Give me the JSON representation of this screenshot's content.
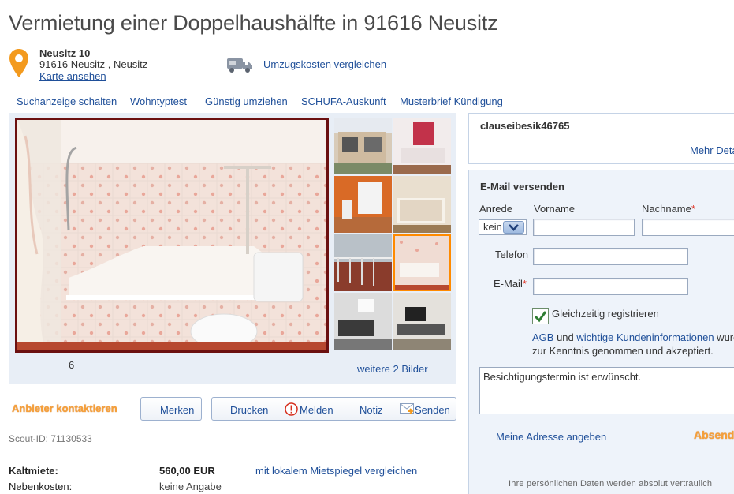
{
  "page_title": "Vermietung einer Doppelhaushälfte in 91616 Neusitz",
  "address": {
    "street": "Neusitz 10",
    "city_line": "91616 Neusitz , Neusitz",
    "map_link": "Karte ansehen"
  },
  "moving_costs_link": "Umzugskosten vergleichen",
  "nav": [
    "Suchanzeige schalten",
    "Wohntyptest",
    "Günstig umziehen",
    "SCHUFA-Auskunft",
    "Musterbrief Kündigung"
  ],
  "gallery": {
    "photo_count": "6",
    "more_photos": "weitere 2 Bilder"
  },
  "actions": {
    "contact_provider": "Anbieter kontaktieren",
    "remember": "Merken",
    "print": "Drucken",
    "report": "Melden",
    "note": "Notiz",
    "send": "Senden"
  },
  "scout_id": "Scout-ID: 71130533",
  "costs": {
    "rent_label": "Kaltmiete:",
    "rent_value": "560,00 EUR",
    "mietspiegel_link": "mit lokalem Mietspiegel vergleichen",
    "extra_label": "Nebenkosten:",
    "extra_value": "keine Angabe"
  },
  "provider": {
    "name": "clauseibesik46765",
    "more_details": "Mehr Deta"
  },
  "mail_form": {
    "heading": "E-Mail versenden",
    "salutation_label": "Anrede",
    "salutation_value": "kein",
    "firstname_label": "Vorname",
    "lastname_label": "Nachname",
    "phone_label": "Telefon",
    "email_label": "E-Mail",
    "required_marker": "*",
    "register_label": "Gleichzeitig registrieren",
    "terms_agb": "AGB",
    "terms_und": " und ",
    "terms_link": "wichtige Kundeninformationen",
    "terms_rest1": " wurd",
    "terms_line2": "zur Kenntnis genommen und akzeptiert.",
    "message": "Besichtigungstermin ist erwünscht.",
    "my_address": "Meine Adresse angeben",
    "send": "Absend",
    "privacy": "Ihre persönlichen Daten werden absolut vertraulich"
  },
  "colors": {
    "link": "#1f4f99",
    "accent_orange": "#f7a039",
    "required": "#e03a2c",
    "panel_bg": "#eef3fa"
  }
}
